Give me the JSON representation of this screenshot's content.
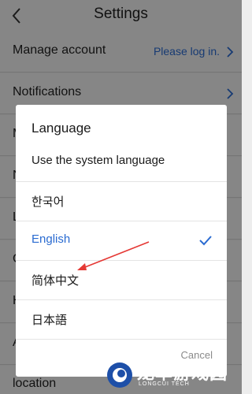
{
  "header": {
    "title": "Settings",
    "back_icon": "chevron-left-icon"
  },
  "settings": {
    "rows": [
      {
        "label": "Manage account",
        "value": "Please log in."
      },
      {
        "label": "Notifications",
        "value": ""
      },
      {
        "label": "M",
        "value": ""
      },
      {
        "label": "N",
        "value": ""
      },
      {
        "label": "L",
        "value": ""
      },
      {
        "label": "C",
        "value": ""
      },
      {
        "label": "H",
        "value": ""
      },
      {
        "label": "A",
        "value": ""
      }
    ],
    "partial_bottom": "location"
  },
  "dialog": {
    "title": "Language",
    "options": [
      {
        "label": "Use the system language",
        "selected": false
      },
      {
        "label": "한국어",
        "selected": false
      },
      {
        "label": "English",
        "selected": true
      },
      {
        "label": "简体中文",
        "selected": false
      },
      {
        "label": "日本語",
        "selected": false
      }
    ],
    "cancel_label": "Cancel"
  },
  "watermark": {
    "text": "龙萃游戏园",
    "subtext": "LONGCUI TECH"
  },
  "colors": {
    "accent": "#2a6bd1",
    "arrow": "#e53935",
    "overlay": "rgba(0,0,0,0.45)"
  }
}
